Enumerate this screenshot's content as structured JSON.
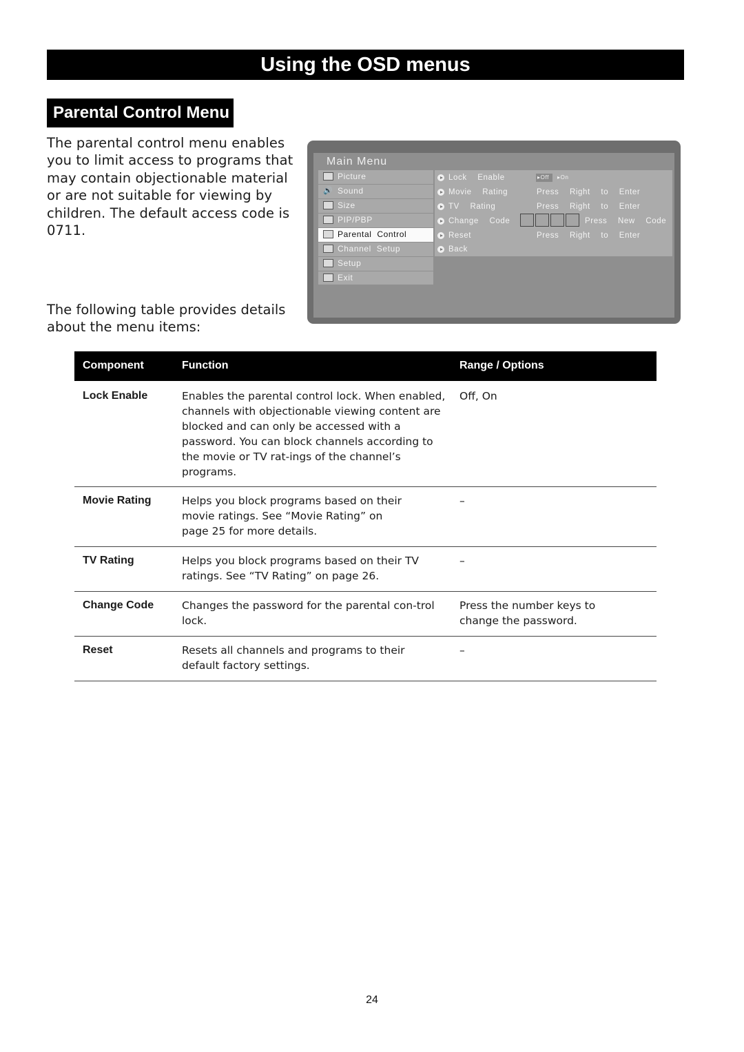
{
  "header": {
    "banner_title": "Using the OSD menus",
    "section_title": "Parental Control Menu"
  },
  "intro": {
    "paragraph1": "The parental control menu enables you to limit access to programs that may contain objectionable material or are not suitable for viewing by children. The default access code is 0711.",
    "paragraph2": "The following table provides details about the menu items:"
  },
  "osd": {
    "title": "Main Menu",
    "left_items": [
      {
        "label": "Picture",
        "icon": "picture-icon",
        "selected": false
      },
      {
        "label": "Sound",
        "icon": "speaker-icon",
        "selected": false
      },
      {
        "label": "Size",
        "icon": "size-icon",
        "selected": false
      },
      {
        "label": "PIP/PBP",
        "icon": "pip-icon",
        "selected": false
      },
      {
        "label": "Parental  Control",
        "icon": "lock-icon",
        "selected": true
      },
      {
        "label": "Channel  Setup",
        "icon": "tv-icon",
        "selected": false
      },
      {
        "label": "Setup",
        "icon": "setup-icon",
        "selected": false
      },
      {
        "label": "Exit",
        "icon": "return-icon",
        "selected": false
      }
    ],
    "right_items": [
      {
        "label": "Lock  Enable",
        "value": ""
      },
      {
        "label": "Movie  Rating",
        "value": "Press  Right  to  Enter"
      },
      {
        "label": "TV  Rating",
        "value": "Press  Right  to  Enter"
      },
      {
        "label": "Change  Code",
        "value": "Press  New  Code"
      },
      {
        "label": "Reset",
        "value": "Press  Right  to  Enter"
      },
      {
        "label": "Back",
        "value": ""
      }
    ],
    "lock_toggle": {
      "off_label": "Off",
      "on_label": "On",
      "selected": "Off"
    }
  },
  "table": {
    "headers": [
      "Component",
      "Function",
      "Range / Options"
    ],
    "rows": [
      {
        "component": "Lock Enable",
        "function": "Enables the parental control lock. When enabled, channels with objectionable viewing content are blocked and can only be accessed with a password. You can block channels according to the movie or TV rat-ings of the channel’s programs.",
        "range": "Off, On"
      },
      {
        "component": "Movie Rating",
        "function": "Helps you block programs based on their movie ratings. See “Movie Rating” on page 25 for more details.",
        "range": "–"
      },
      {
        "component": "TV Rating",
        "function": "Helps you block programs based on their TV ratings. See “TV Rating” on page 26.",
        "range": "–"
      },
      {
        "component": "Change Code",
        "function": "Changes the password for the parental con-trol lock.",
        "range": "Press the number keys to change the password."
      },
      {
        "component": "Reset",
        "function": "Resets all channels and programs to their default factory settings.",
        "range": "–"
      }
    ]
  },
  "footer": {
    "page_number": "24"
  }
}
